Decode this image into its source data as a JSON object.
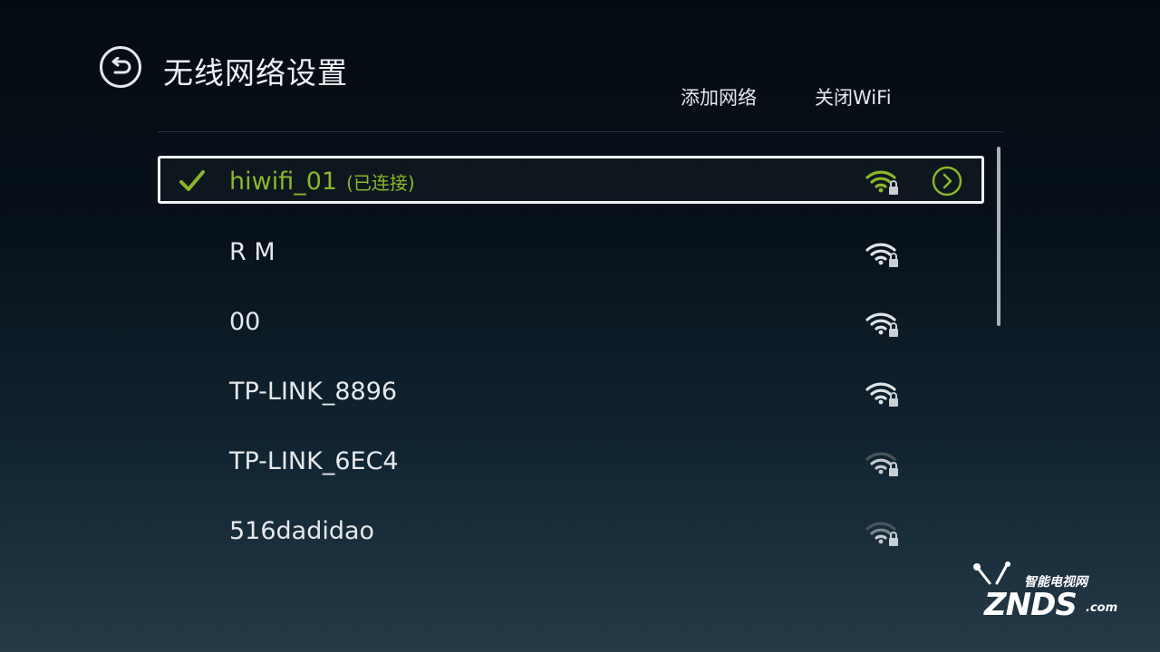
{
  "header": {
    "title": "无线网络设置",
    "add_network": "添加网络",
    "turn_off_wifi": "关闭WiFi"
  },
  "networks": [
    {
      "ssid": "hiwifi_01",
      "status": "(已连接)",
      "connected": true,
      "signal_level": 4,
      "secured": true
    },
    {
      "ssid": "R M",
      "connected": false,
      "signal_level": 4,
      "secured": true
    },
    {
      "ssid": "00",
      "connected": false,
      "signal_level": 4,
      "secured": true
    },
    {
      "ssid": "TP-LINK_8896",
      "connected": false,
      "signal_level": 4,
      "secured": true
    },
    {
      "ssid": "TP-LINK_6EC4",
      "connected": false,
      "signal_level": 2,
      "secured": true
    },
    {
      "ssid": "516dadidao",
      "connected": false,
      "signal_level": 2,
      "secured": true
    }
  ],
  "icons": {
    "back": "back-arrow-icon",
    "check": "checkmark-icon",
    "wifi": "wifi-lock-icon",
    "detail": "chevron-right-circle-icon"
  },
  "colors": {
    "accent": "#8db52a",
    "text": "#e6e9ec",
    "wifi_full": "#dfe3e6",
    "wifi_weak": "#7c868d"
  },
  "watermark": {
    "cn": "智能电视网",
    "en": "ZNDS",
    "suffix": ".com"
  }
}
